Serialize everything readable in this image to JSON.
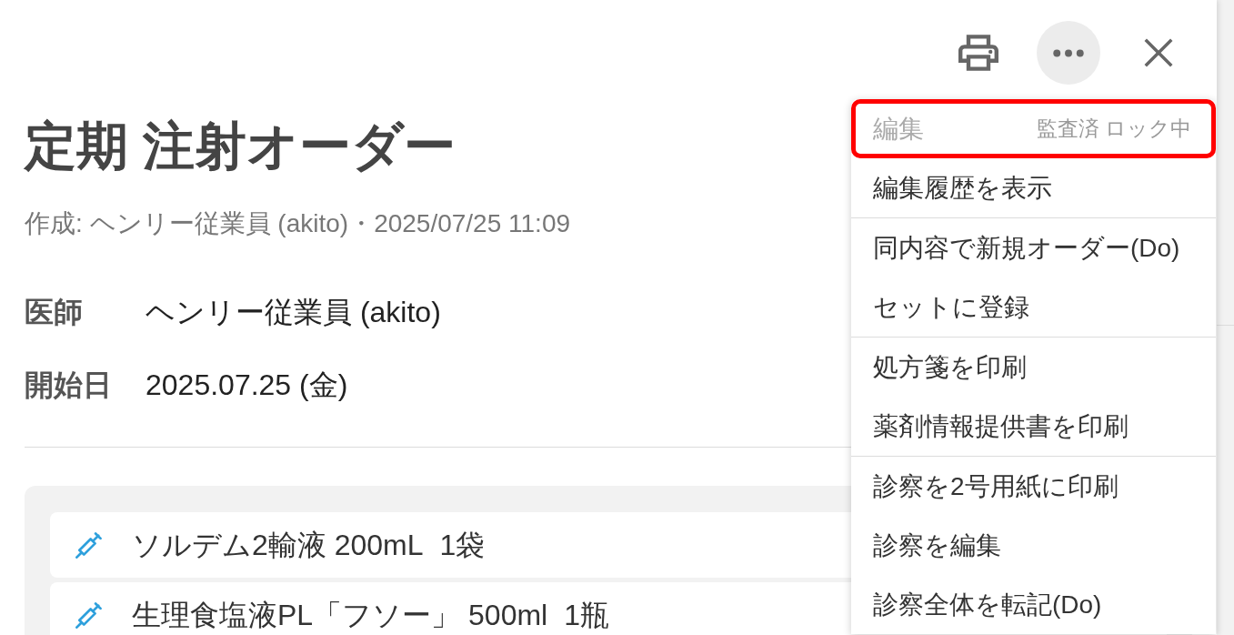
{
  "toolbar": {
    "buttons": [
      {
        "kind": "print",
        "active": false
      },
      {
        "kind": "more",
        "active": true
      },
      {
        "kind": "close",
        "active": false
      }
    ]
  },
  "order": {
    "title": "定期 注射オーダー",
    "meta": "作成: ヘンリー従業員 (akito)・2025/07/25 11:09",
    "fields": [
      {
        "label": "医師",
        "value": "ヘンリー従業員 (akito)"
      },
      {
        "label": "開始日",
        "value": "2025.07.25 (金)"
      }
    ],
    "items": [
      {
        "name": "ソルデム2輸液 200mL",
        "quantity": "1袋"
      },
      {
        "name": "生理食塩液PL「フソー」 500ml",
        "quantity": "1瓶"
      }
    ]
  },
  "menu": {
    "groups": [
      {
        "items": [
          {
            "label": "編集",
            "note": "監査済 ロック中",
            "disabled": true,
            "highlighted": true
          },
          {
            "label": "編集履歴を表示",
            "disabled": false,
            "highlighted": false
          }
        ]
      },
      {
        "items": [
          {
            "label": "同内容で新規オーダー(Do)",
            "disabled": false,
            "highlighted": false
          },
          {
            "label": "セットに登録",
            "disabled": false,
            "highlighted": false
          }
        ]
      },
      {
        "items": [
          {
            "label": "処方箋を印刷",
            "disabled": false,
            "highlighted": false
          },
          {
            "label": "薬剤情報提供書を印刷",
            "disabled": false,
            "highlighted": false
          }
        ]
      },
      {
        "items": [
          {
            "label": "診察を2号用紙に印刷",
            "disabled": false,
            "highlighted": false
          },
          {
            "label": "診察を編集",
            "disabled": false,
            "highlighted": false
          },
          {
            "label": "診察全体を転記(Do)",
            "disabled": false,
            "highlighted": false
          }
        ]
      }
    ]
  }
}
